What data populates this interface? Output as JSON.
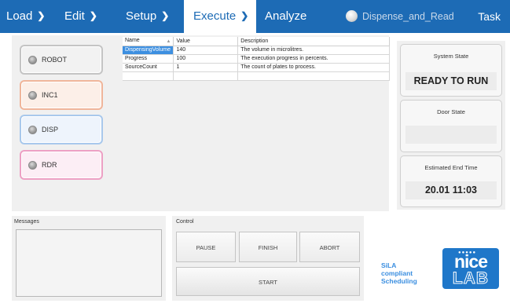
{
  "nav": {
    "items": [
      {
        "label": "Load",
        "chevron": "❯"
      },
      {
        "label": "Edit",
        "chevron": "❯"
      },
      {
        "label": "Setup",
        "chevron": "❯"
      },
      {
        "label": "Execute",
        "chevron": "❯"
      },
      {
        "label": "Analyze"
      }
    ],
    "active": "Execute",
    "process_name": "Dispense_and_Read",
    "task_label": "Task",
    "status_icon": "status-light-icon"
  },
  "devices": [
    {
      "label": "ROBOT",
      "color": "#c4c4c4"
    },
    {
      "label": "INC1",
      "color": "#f0b59a"
    },
    {
      "label": "DISP",
      "color": "#a8c8ec"
    },
    {
      "label": "RDR",
      "color": "#eda0c4"
    }
  ],
  "parameters": {
    "columns": [
      "Name",
      "Value",
      "Description"
    ],
    "rows": [
      {
        "name": "DispensingVolume",
        "value": "140",
        "description": "The volume in microlitres."
      },
      {
        "name": "Progress",
        "value": "100",
        "description": "The execution progress in percents."
      },
      {
        "name": "SourceCount",
        "value": "1",
        "description": "The count of plates to process."
      }
    ]
  },
  "state": {
    "system_title": "System State",
    "system_value": "READY TO RUN",
    "door_title": "Door State",
    "door_value": "",
    "end_title": "Estimated End Time",
    "end_value": "20.01 11:03"
  },
  "messages": {
    "label": "Messages",
    "content": ""
  },
  "control": {
    "label": "Control",
    "pause": "PAUSE",
    "finish": "FINISH",
    "abort": "ABORT",
    "start": "START"
  },
  "branding": {
    "sila_line1": "SiLA",
    "sila_line2": "compliant",
    "sila_line3": "Scheduling",
    "logo_top": "●●●●●",
    "logo_main": "nice",
    "logo_sub": "LAB"
  },
  "colors": {
    "accent": "#1d6bb5",
    "selection": "#3d8fe0",
    "sila_blue": "#3a8ee0"
  }
}
